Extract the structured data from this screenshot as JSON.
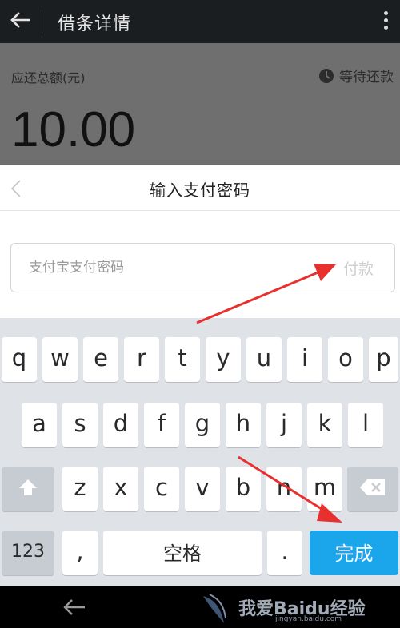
{
  "appbar": {
    "title": "借条详情"
  },
  "detail": {
    "amount_label": "应还总额(元)",
    "status": "等待还款",
    "amount": "10.00"
  },
  "sheet": {
    "title": "输入支付密码",
    "password_placeholder": "支付宝支付密码",
    "pay_label": "付款"
  },
  "keyboard": {
    "row1": [
      "q",
      "w",
      "e",
      "r",
      "t",
      "y",
      "u",
      "i",
      "o",
      "p"
    ],
    "row2": [
      "a",
      "s",
      "d",
      "f",
      "g",
      "h",
      "j",
      "k",
      "l"
    ],
    "row3": [
      "z",
      "x",
      "c",
      "v",
      "b",
      "n",
      "m"
    ],
    "num_label": "123",
    "comma": ",",
    "space_label": "空格",
    "period": ".",
    "done_label": "完成"
  },
  "watermark": {
    "text": "我爱Baidu经验",
    "sub": "jingyan.baidu.com"
  },
  "colors": {
    "accent": "#1ba5ea",
    "arrow": "#e8312f",
    "overlay": "#6f6f6f"
  }
}
